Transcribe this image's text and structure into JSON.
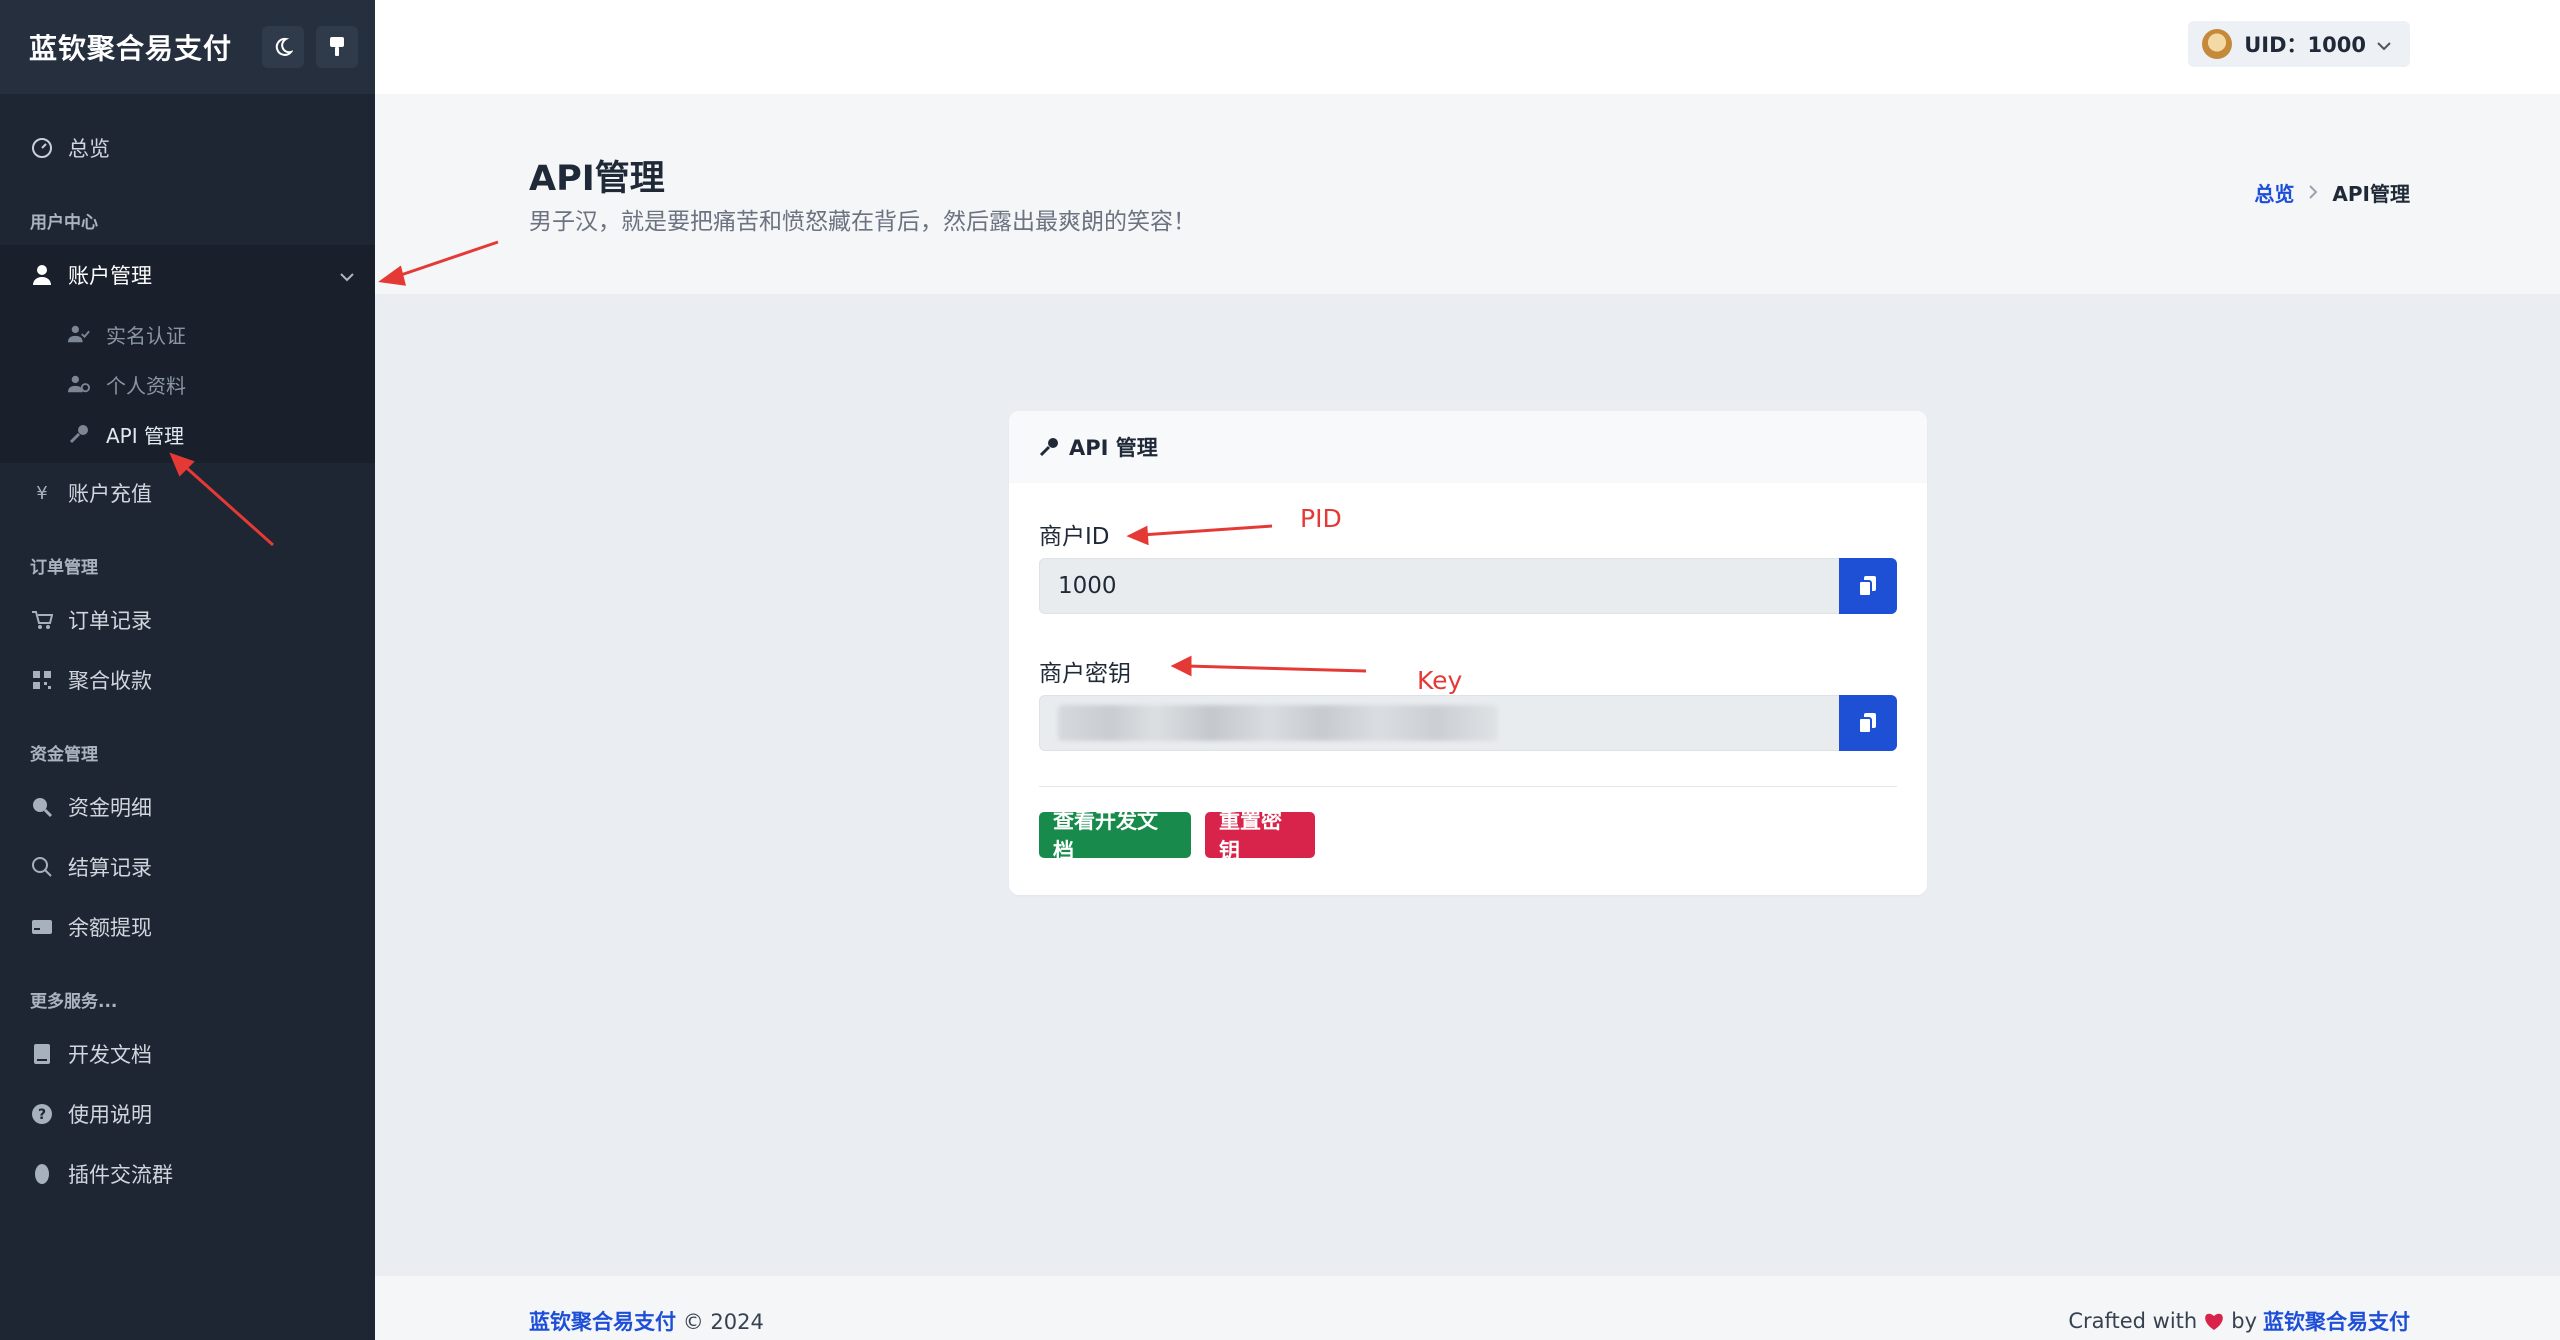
{
  "sidebar": {
    "brand": "蓝钦聚合易支付",
    "nav": {
      "overview": "总览",
      "section_user": "用户中心",
      "account_mgmt": "账户管理",
      "sub_realname": "实名认证",
      "sub_profile": "个人资料",
      "sub_api": "API 管理",
      "recharge": "账户充值",
      "section_order": "订单管理",
      "orders": "订单记录",
      "aggregate": "聚合收款",
      "section_funds": "资金管理",
      "funds_detail": "资金明细",
      "settlement": "结算记录",
      "withdraw": "余额提现",
      "section_more": "更多服务...",
      "dev_docs": "开发文档",
      "usage": "使用说明",
      "plugin_group": "插件交流群"
    }
  },
  "topbar": {
    "user": "UID：1000"
  },
  "hero": {
    "title": "API管理",
    "subtitle": "男子汉，就是要把痛苦和愤怒藏在背后，然后露出最爽朗的笑容！",
    "breadcrumb_home": "总览",
    "breadcrumb_current": "API管理"
  },
  "card": {
    "title": "API 管理",
    "pid_label": "商户ID",
    "pid_value": "1000",
    "key_label": "商户密钥",
    "btn_docs": "查看开发文档",
    "btn_reset": "重置密钥"
  },
  "annotations": {
    "pid": "PID",
    "key": "Key"
  },
  "footer": {
    "brand": "蓝钦聚合易支付",
    "copyright": "© 2024",
    "crafted": "Crafted with",
    "by": "by"
  },
  "colors": {
    "sidebar_bg": "#1e2633",
    "primary": "#1e50d6",
    "success": "#178a4c",
    "danger": "#d8244a",
    "annotation": "#e53935"
  }
}
